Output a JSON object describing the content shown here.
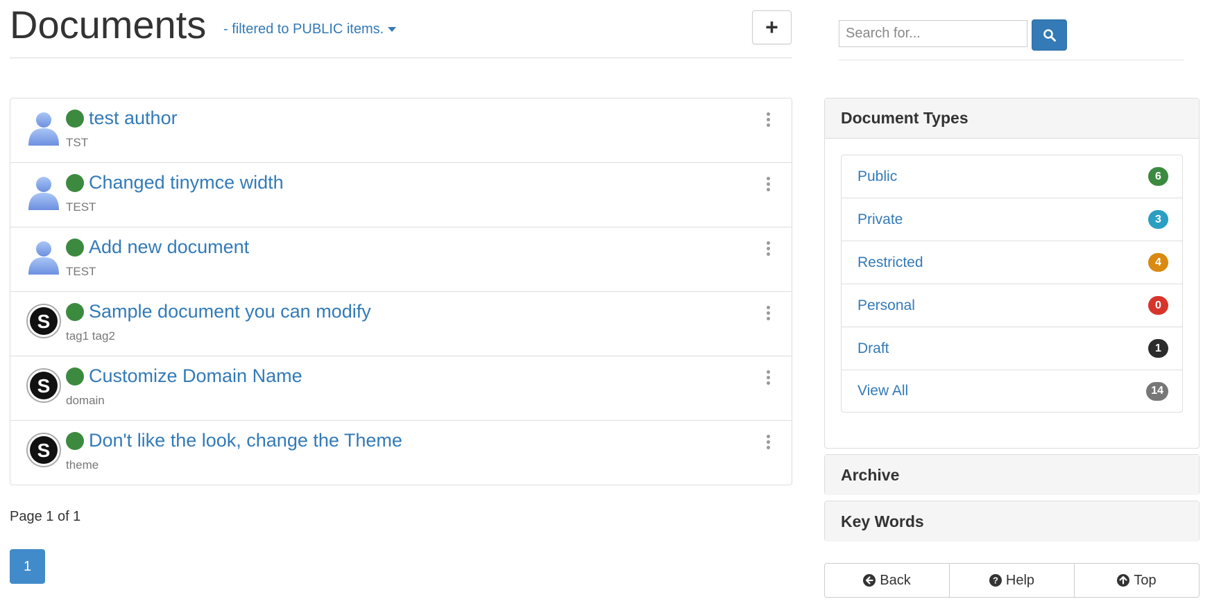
{
  "header": {
    "title": "Documents",
    "filter_label": "- filtered to PUBLIC items.",
    "add_label": "+"
  },
  "documents": [
    {
      "title": "test author",
      "tags": "TST",
      "avatar": "user-silhouette-icon"
    },
    {
      "title": "Changed tinymce width",
      "tags": "TEST",
      "avatar": "user-silhouette-icon"
    },
    {
      "title": "Add new document",
      "tags": "TEST",
      "avatar": "user-silhouette-icon"
    },
    {
      "title": "Sample document you can modify",
      "tags": "tag1 tag2",
      "avatar": "s-logo-icon"
    },
    {
      "title": "Customize Domain Name",
      "tags": "domain",
      "avatar": "s-logo-icon"
    },
    {
      "title": "Don't like the look, change the Theme",
      "tags": "theme",
      "avatar": "s-logo-icon"
    }
  ],
  "pagination": {
    "info": "Page 1 of 1",
    "current": "1"
  },
  "search": {
    "placeholder": "Search for..."
  },
  "sidebar": {
    "doc_types_heading": "Document Types",
    "doc_types": [
      {
        "label": "Public",
        "count": "6",
        "color": "#3c8a3f"
      },
      {
        "label": "Private",
        "count": "3",
        "color": "#2b9fc2"
      },
      {
        "label": "Restricted",
        "count": "4",
        "color": "#d98a10"
      },
      {
        "label": "Personal",
        "count": "0",
        "color": "#d7352c"
      },
      {
        "label": "Draft",
        "count": "1",
        "color": "#2c2c2c"
      },
      {
        "label": "View All",
        "count": "14",
        "color": "#777777"
      }
    ],
    "archive_heading": "Archive",
    "keywords_heading": "Key Words"
  },
  "footer_nav": {
    "back_label": "Back",
    "help_label": "Help",
    "top_label": "Top"
  },
  "colors": {
    "link": "#337ab7",
    "status_public": "#3c8a3f"
  }
}
